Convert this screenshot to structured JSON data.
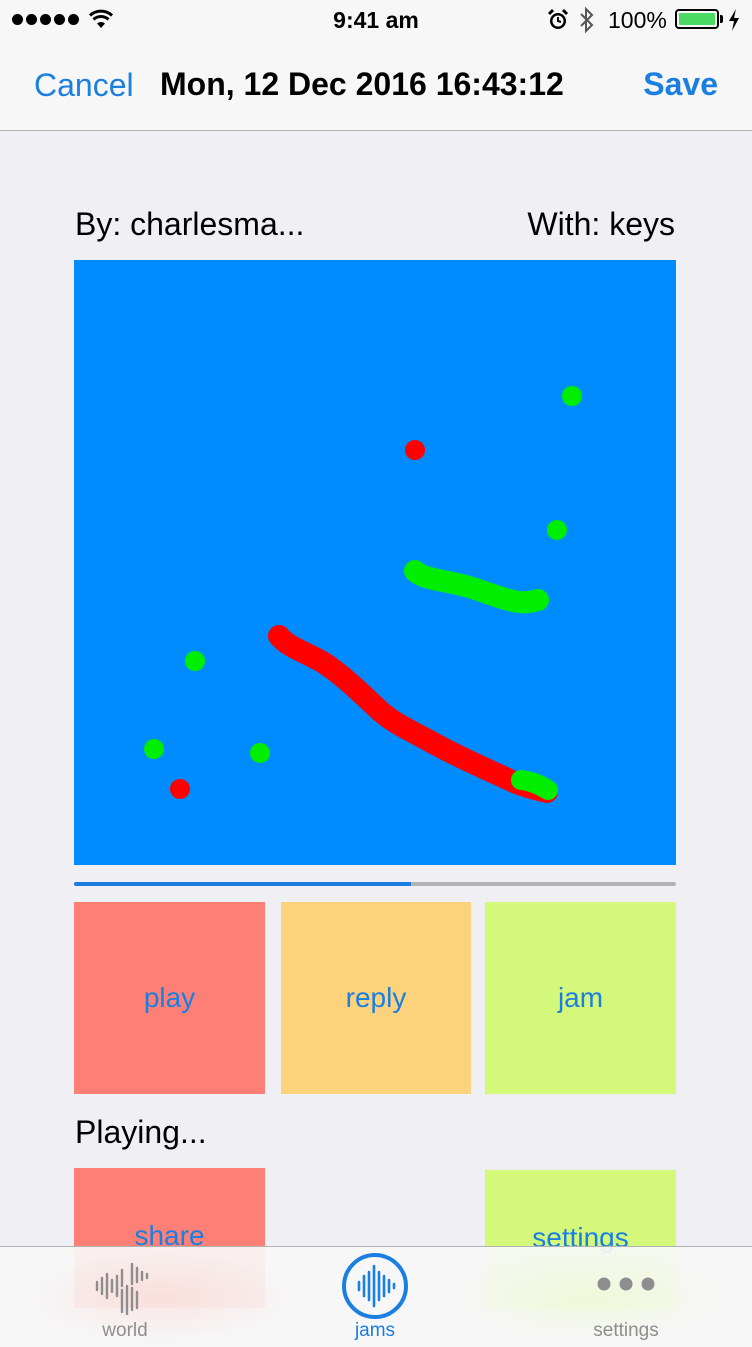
{
  "status_bar": {
    "time": "9:41 am",
    "battery": "100%",
    "icons": [
      "signal-dots-icon",
      "wifi-icon",
      "alarm-icon",
      "bluetooth-icon",
      "battery-icon",
      "charging-bolt-icon"
    ]
  },
  "nav": {
    "cancel": "Cancel",
    "title": "Mon, 12 Dec 2016 16:43:12",
    "save": "Save"
  },
  "jam": {
    "by": "By: charlesma...",
    "with": "With: keys",
    "canvas_color": "#008cff",
    "progress_fraction": 0.56
  },
  "buttons": {
    "play": "play",
    "reply": "reply",
    "jam": "jam",
    "share": "share",
    "settings": "settings"
  },
  "status_text": "Playing...",
  "tabs": [
    {
      "label": "world",
      "icon": "world-waveform-icon",
      "active": false
    },
    {
      "label": "jams",
      "icon": "jams-waveform-icon",
      "active": true
    },
    {
      "label": "settings",
      "icon": "more-dots-icon",
      "active": false
    }
  ],
  "colors": {
    "accent": "#1a7fe0",
    "red_stroke": "#ff0000",
    "green_stroke": "#00ee00",
    "play_bg": "#fd7f76",
    "reply_bg": "#fdd27c",
    "jam_bg": "#d4f97a"
  }
}
